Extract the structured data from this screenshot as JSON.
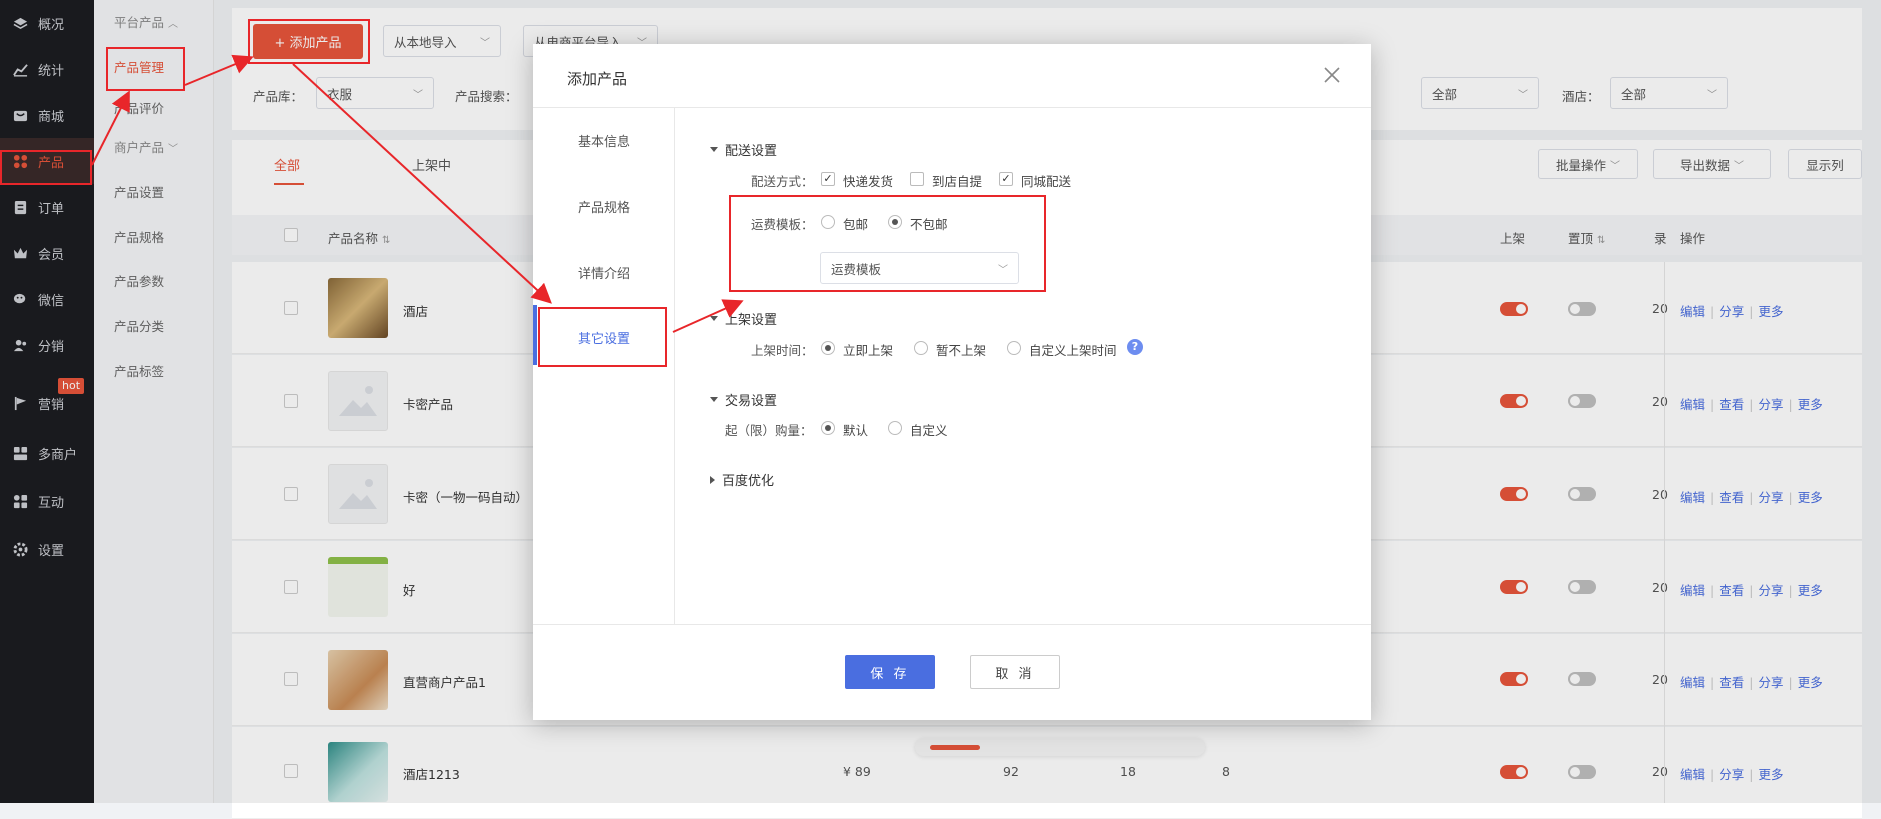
{
  "nav": {
    "items": [
      {
        "label": "概况",
        "icon": "layers-icon"
      },
      {
        "label": "统计",
        "icon": "chart-icon"
      },
      {
        "label": "商城",
        "icon": "store-icon"
      },
      {
        "label": "产品",
        "icon": "grid-icon"
      },
      {
        "label": "订单",
        "icon": "order-icon"
      },
      {
        "label": "会员",
        "icon": "crown-icon"
      },
      {
        "label": "微信",
        "icon": "wechat-icon"
      },
      {
        "label": "分销",
        "icon": "users-icon"
      },
      {
        "label": "营销",
        "icon": "flag-icon"
      },
      {
        "label": "多商户",
        "icon": "shop-icon"
      },
      {
        "label": "互动",
        "icon": "apps-icon"
      },
      {
        "label": "设置",
        "icon": "gear-icon"
      }
    ],
    "hot_badge": "hot"
  },
  "subnav": {
    "group1": "平台产品",
    "items1": [
      "产品管理",
      "产品评价"
    ],
    "group2": "商户产品",
    "items2": [
      "产品设置",
      "产品规格",
      "产品参数",
      "产品分类",
      "产品标签"
    ]
  },
  "toolbar": {
    "add_product": "+ 添加产品",
    "import_local": "从本地导入",
    "import_ecom": "从电商平台导入"
  },
  "filters": {
    "lib_label": "产品库：",
    "lib_value": "衣服",
    "search_label": "产品搜索：",
    "all_value_1": "全部",
    "hotel_label": "酒店：",
    "hotel_value": "全部"
  },
  "tabs": [
    "全部",
    "上架中"
  ],
  "actions": {
    "batch": "批量操作",
    "export": "导出数据",
    "columns": "显示列"
  },
  "table": {
    "col_name": "产品名称",
    "col_on": "上架",
    "col_top": "置顶",
    "col_ops": "操作",
    "col_partial": "录",
    "rows": [
      {
        "name": "酒店",
        "partial": "20",
        "ops": [
          "编辑",
          "分享",
          "更多"
        ]
      },
      {
        "name": "卡密产品",
        "partial": "20",
        "ops": [
          "编辑",
          "查看",
          "分享",
          "更多"
        ]
      },
      {
        "name": "卡密（一物一码自动）",
        "partial": "20",
        "ops": [
          "编辑",
          "查看",
          "分享",
          "更多"
        ]
      },
      {
        "name": "好",
        "partial": "20",
        "ops": [
          "编辑",
          "查看",
          "分享",
          "更多"
        ]
      },
      {
        "name": "直营商户产品1",
        "partial": "20",
        "ops": [
          "编辑",
          "查看",
          "分享",
          "更多"
        ]
      },
      {
        "name": "酒店1213",
        "price": "¥ 89",
        "c1": "92",
        "c2": "18",
        "c3": "8",
        "partial": "20",
        "ops": [
          "编辑",
          "分享",
          "更多"
        ]
      }
    ]
  },
  "modal": {
    "title": "添加产品",
    "side_tabs": [
      "基本信息",
      "产品规格",
      "详情介绍",
      "其它设置"
    ],
    "delivery": {
      "section": "配送设置",
      "method_label": "配送方式：",
      "options": [
        "快递发货",
        "到店自提",
        "同城配送"
      ],
      "fee_label": "运费模板：",
      "fee_options": [
        "包邮",
        "不包邮"
      ],
      "template_placeholder": "运费模板"
    },
    "listing": {
      "section": "上架设置",
      "time_label": "上架时间：",
      "options": [
        "立即上架",
        "暂不上架",
        "自定义上架时间"
      ]
    },
    "trade": {
      "section": "交易设置",
      "qty_label": "起（限）购量：",
      "options": [
        "默认",
        "自定义"
      ]
    },
    "seo": {
      "section": "百度优化"
    },
    "save": "保 存",
    "cancel": "取 消"
  }
}
